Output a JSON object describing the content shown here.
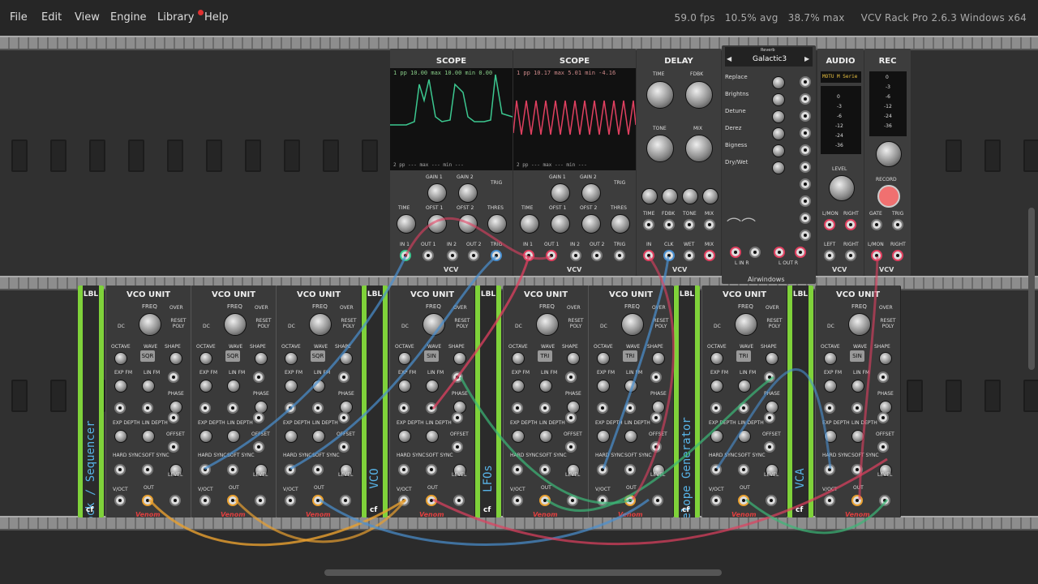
{
  "menu": {
    "items": [
      "File",
      "Edit",
      "View",
      "Engine",
      "Library",
      "Help"
    ]
  },
  "status": {
    "fps": "59.0 fps",
    "avg": "10.5% avg",
    "max": "38.7% max",
    "app": "VCV Rack Pro 2.6.3 Windows x64"
  },
  "modules_top": {
    "scope1": {
      "title": "SCOPE",
      "readout": "1 pp  10.00  max 10.00  min  0.00",
      "footer": "2 pp  ---  max  ---  min  ---",
      "labels": [
        "GAIN 1",
        "GAIN 2",
        "TRIG",
        "TIME",
        "OFST 1",
        "OFST 2",
        "THRES",
        "IN 1",
        "OUT 1",
        "IN 2",
        "OUT 2",
        "TRIG"
      ],
      "brand": "VCV"
    },
    "scope2": {
      "title": "SCOPE",
      "readout": "1 pp  10.17  max  5.01  min -4.16",
      "footer": "2 pp  ---  max  ---  min  ---",
      "labels": [
        "GAIN 1",
        "GAIN 2",
        "TRIG",
        "TIME",
        "OFST 1",
        "OFST 2",
        "THRES",
        "IN 1",
        "OUT 1",
        "IN 2",
        "OUT 2",
        "TRIG"
      ],
      "brand": "VCV"
    },
    "delay": {
      "title": "DELAY",
      "labels": [
        "TIME",
        "FDBK",
        "TONE",
        "MIX",
        "TIME",
        "FDBK",
        "TONE",
        "MIX",
        "IN",
        "CLK",
        "WET",
        "MIX"
      ],
      "brand": "VCV"
    },
    "reverb": {
      "header": "Reverb",
      "preset": "Galactic3",
      "params": [
        "Replace",
        "Brightns",
        "Detune",
        "Derez",
        "Bigness",
        "Dry/Wet"
      ],
      "io_in": "L  IN  R",
      "io_out": "L  OUT  R",
      "brand": "Airwindows"
    },
    "audio": {
      "title": "AUDIO",
      "device": "MOTU M Serie",
      "levels": [
        "0",
        "-3",
        "-6",
        "-12",
        "-24",
        "-36"
      ],
      "labels": [
        "LEVEL",
        "L/MON",
        "RIGHT",
        "LEFT",
        "RIGHT"
      ],
      "brand": "VCV"
    },
    "rec": {
      "title": "REC",
      "levels": [
        "0",
        "-3",
        "-6",
        "-12",
        "-24",
        "-36"
      ],
      "labels": [
        "LEVEL",
        "RECORD",
        "GATE",
        "TRIG",
        "L/MON",
        "RIGHT"
      ],
      "brand": "VCV"
    }
  },
  "vco": {
    "title": "VCO UNIT",
    "labels": [
      "FREQ",
      "OVER",
      "DC",
      "RESET POLY",
      "OCTAVE",
      "WAVE",
      "SHAPE",
      "EXP FM",
      "LIN FM",
      "PHASE",
      "EXP DEPTH",
      "LIN DEPTH",
      "OFFSET",
      "HARD SYNC",
      "SOFT SYNC",
      "LEVEL",
      "V/OCT",
      "OUT"
    ],
    "brand": "Venom",
    "units": [
      {
        "wave": "SQR"
      },
      {
        "wave": "SQR"
      },
      {
        "wave": "SQR"
      },
      {
        "wave": "SIN"
      },
      {
        "wave": "TRI"
      },
      {
        "wave": "TRI"
      },
      {
        "wave": "TRI"
      },
      {
        "wave": "SIN"
      }
    ]
  },
  "labels_vertical": [
    {
      "top": "LBL",
      "text": "Clock / Sequencer",
      "badge": "cf"
    },
    {
      "top": "LBL",
      "text": "VCO",
      "badge": "cf"
    },
    {
      "top": "LBL",
      "text": "LFOs",
      "badge": "cf"
    },
    {
      "top": "LBL",
      "text": "Envelope Generator",
      "badge": "cf"
    },
    {
      "top": "LBL",
      "text": "VCA",
      "badge": "cf"
    }
  ]
}
